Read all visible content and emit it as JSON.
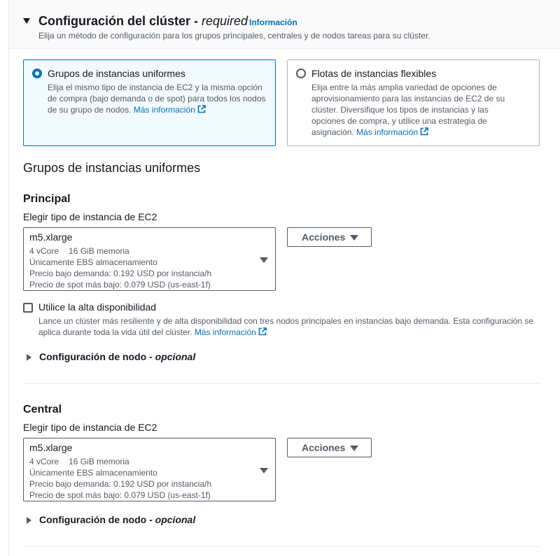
{
  "header": {
    "title": "Configuración del clúster",
    "separator": " - ",
    "required": "required",
    "info_link": "Información",
    "description": "Elija un método de configuración para los grupos principales, centrales y de nodos tareas para su clúster."
  },
  "tiles": [
    {
      "title": "Grupos de instancias uniformes",
      "description": "Elija el mismo tipo de instancia de EC2 y la misma opción de compra (bajo demanda o de spot) para todos los nodos de su grupo de nodos.",
      "link": "Más información",
      "selected": true
    },
    {
      "title": "Flotas de instancias flexibles",
      "description": "Elija entre la más amplia variedad de opciones de aprovisionamiento para las instancias de EC2 de su clúster. Diversifique los tipos de instancias y las opciones de compra, y utilice una estrategia de asignación.",
      "link": "Más información",
      "selected": false
    }
  ],
  "section_heading": "Grupos de instancias uniformes",
  "primary": {
    "title": "Principal",
    "field_label": "Elegir tipo de instancia de EC2",
    "instance": {
      "name": "m5.xlarge",
      "vcpu": "4 vCore",
      "memory": "16 GiB memoria",
      "storage": "Únicamente EBS almacenamiento",
      "on_demand_price": "Precio bajo demanda: 0.192 USD por instancia/h",
      "spot_price": "Precio de spot más bajo: 0.079 USD (us-east-1f)"
    },
    "actions_label": "Acciones",
    "high_availability": {
      "label": "Utilice la alta disponibilidad",
      "description": "Lance un clúster más resiliente y de alta disponibilidad con tres nodos principales en instancias bajo demanda. Esta configuración se aplica durante toda la vida útil del clúster.",
      "link": "Más información",
      "checked": false
    },
    "node_config": {
      "label": "Configuración de nodo",
      "separator": " - ",
      "optional": "opcional"
    }
  },
  "core": {
    "title": "Central",
    "field_label": "Elegir tipo de instancia de EC2",
    "instance": {
      "name": "m5.xlarge",
      "vcpu": "4 vCore",
      "memory": "16 GiB memoria",
      "storage": "Únicamente EBS almacenamiento",
      "on_demand_price": "Precio bajo demanda: 0.192 USD por instancia/h",
      "spot_price": "Precio de spot más bajo: 0.079 USD (us-east-1f)"
    },
    "actions_label": "Acciones",
    "node_config": {
      "label": "Configuración de nodo",
      "separator": " - ",
      "optional": "opcional"
    }
  },
  "colors": {
    "accent": "#0073bb",
    "text": "#16191f",
    "muted": "#545b64",
    "border": "#aab7b8",
    "selected_bg": "#f1faff"
  }
}
